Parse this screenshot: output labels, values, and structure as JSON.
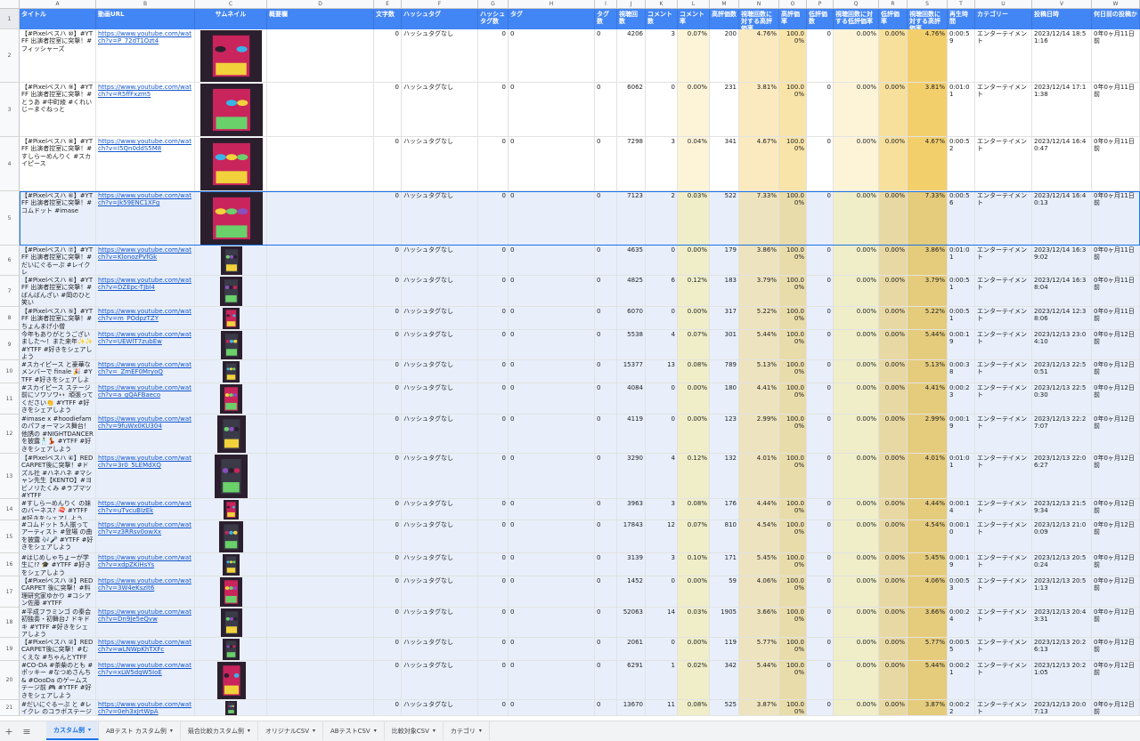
{
  "column_letters": [
    "A",
    "B",
    "C",
    "D",
    "E",
    "F",
    "G",
    "H",
    "I",
    "J",
    "K",
    "L",
    "M",
    "N",
    "O",
    "P",
    "Q",
    "R",
    "S",
    "T",
    "U",
    "V",
    "W"
  ],
  "headers": [
    "タイトル",
    "動画URL",
    "サムネイル",
    "概要欄",
    "文字数",
    "ハッシュタグ",
    "ハッシュタグ数",
    "タグ",
    "タグ数",
    "視聴回数",
    "コメント数",
    "コメント率",
    "高評価数",
    "視聴回数に対する高評価率",
    "高評価率",
    "低評価数",
    "視聴回数に対する低評価率",
    "低評価率",
    "視聴回数に対する高評価率",
    "再生時間",
    "カテゴリー",
    "投稿日時",
    "何日前の投稿か"
  ],
  "row_numbers": [
    "1",
    "2",
    "3",
    "4",
    "5",
    "6",
    "7",
    "8",
    "9",
    "10",
    "11",
    "12",
    "13",
    "14",
    "15",
    "16",
    "17",
    "18",
    "19",
    "20",
    "21"
  ],
  "rows": [
    {
      "title": "【#Pixelベスハ ⑩】#YTFF 出演者控室に突撃！#フィッシャーズ",
      "url": "https://www.youtube.com/watch?v=P_72dT1Ozt4",
      "desc": "",
      "chars": "0",
      "hashtag": "ハッシュタグなし",
      "htcount": "0",
      "tag": "0",
      "tagcount": "0",
      "views": "4206",
      "comments": "3",
      "crate": "0.07%",
      "likes": "200",
      "lvrate": "4.76%",
      "lrate": "100.00%",
      "dislikes": "0",
      "dvrate": "0.00%",
      "drate": "0.00%",
      "lvrate2": "4.76%",
      "duration": "0:00:59",
      "category": "エンターテイメント",
      "posted": "2023/12/14 18:51:16",
      "ago": "0年0ヶ月11日前"
    },
    {
      "title": "【#Pixelベスハ ⑨】#YTFF 出演者控室に突撃！#とうあ #中町綾 #くれいじーまぐねっと",
      "url": "https://www.youtube.com/watch?v=R5ffFxzm5",
      "desc": "",
      "chars": "0",
      "hashtag": "ハッシュタグなし",
      "htcount": "0",
      "tag": "0",
      "tagcount": "0",
      "views": "6062",
      "comments": "0",
      "crate": "0.00%",
      "likes": "231",
      "lvrate": "3.81%",
      "lrate": "100.00%",
      "dislikes": "0",
      "dvrate": "0.00%",
      "drate": "0.00%",
      "lvrate2": "3.81%",
      "duration": "0:01:01",
      "category": "エンターテイメント",
      "posted": "2023/12/14 17:11:38",
      "ago": "0年0ヶ月11日前"
    },
    {
      "title": "【#Pixelベスハ ⑧】#YTFF 出演者控室に突撃！#すしらーめんりく #スカイピース",
      "url": "https://www.youtube.com/watch?v=I5Qn0ddS5M8",
      "desc": "",
      "chars": "0",
      "hashtag": "ハッシュタグなし",
      "htcount": "0",
      "tag": "0",
      "tagcount": "0",
      "views": "7298",
      "comments": "3",
      "crate": "0.04%",
      "likes": "341",
      "lvrate": "4.67%",
      "lrate": "100.00%",
      "dislikes": "0",
      "dvrate": "0.00%",
      "drate": "0.00%",
      "lvrate2": "4.67%",
      "duration": "0:00:52",
      "category": "エンターテイメント",
      "posted": "2023/12/14 16:40:47",
      "ago": "0年0ヶ月11日前"
    },
    {
      "title": "【#Pixelベスハ ⑥】#YTFF 出演者控室に突撃！#コムドット #imase",
      "url": "https://www.youtube.com/watch?v=Jk59ENC1XFg",
      "desc": "",
      "chars": "0",
      "hashtag": "ハッシュタグなし",
      "htcount": "0",
      "tag": "0",
      "tagcount": "0",
      "views": "7123",
      "comments": "2",
      "crate": "0.03%",
      "likes": "522",
      "lvrate": "7.33%",
      "lrate": "100.00%",
      "dislikes": "0",
      "dvrate": "0.00%",
      "drate": "0.00%",
      "lvrate2": "7.33%",
      "duration": "0:00:56",
      "category": "エンターテイメント",
      "posted": "2023/12/14 16:40:13",
      "ago": "0年0ヶ月11日前"
    },
    {
      "title": "【#Pixelベスハ ⑦】#YTFF 出演者控室に突撃！#だいにぐるーぷ #レイクレ",
      "url": "https://www.youtube.com/watch?v=KlonozPVfGk",
      "desc": "",
      "chars": "0",
      "hashtag": "ハッシュタグなし",
      "htcount": "0",
      "tag": "0",
      "tagcount": "0",
      "views": "4635",
      "comments": "0",
      "crate": "0.00%",
      "likes": "179",
      "lvrate": "3.86%",
      "lrate": "100.00%",
      "dislikes": "0",
      "dvrate": "0.00%",
      "drate": "0.00%",
      "lvrate2": "3.86%",
      "duration": "0:01:01",
      "category": "エンターテイメント",
      "posted": "2023/12/14 16:39:02",
      "ago": "0年0ヶ月11日前"
    },
    {
      "title": "【#Pixelベスハ ⑥】#YTFF 出演者控室に突撃！#ばんばんざい #岡のひと笑い",
      "url": "https://www.youtube.com/watch?v=DZEpc-TJbl4",
      "desc": "",
      "chars": "0",
      "hashtag": "ハッシュタグなし",
      "htcount": "0",
      "tag": "0",
      "tagcount": "0",
      "views": "4825",
      "comments": "6",
      "crate": "0.12%",
      "likes": "183",
      "lvrate": "3.79%",
      "lrate": "100.00%",
      "dislikes": "0",
      "dvrate": "0.00%",
      "drate": "0.00%",
      "lvrate2": "3.79%",
      "duration": "0:00:51",
      "category": "エンターテイメント",
      "posted": "2023/12/14 16:38:04",
      "ago": "0年0ヶ月11日前"
    },
    {
      "title": "【#Pixelベスハ ⑤】#YTFF 出演者控室に突撃！#ちょんまげ小僧",
      "url": "https://www.youtube.com/watch?v=m_POdpzTZY",
      "desc": "",
      "chars": "0",
      "hashtag": "ハッシュタグなし",
      "htcount": "0",
      "tag": "0",
      "tagcount": "0",
      "views": "6070",
      "comments": "0",
      "crate": "0.00%",
      "likes": "317",
      "lvrate": "5.22%",
      "lrate": "100.00%",
      "dislikes": "0",
      "dvrate": "0.00%",
      "drate": "0.00%",
      "lvrate2": "5.22%",
      "duration": "0:00:51",
      "category": "エンターテイメント",
      "posted": "2023/12/14 12:38:06",
      "ago": "0年0ヶ月11日前"
    },
    {
      "title": "今年もありがとうございました〜！また来年✨✨ #YTFF #好きをシェアしよう",
      "url": "https://www.youtube.com/watch?v=UEWlT7zubEw",
      "desc": "",
      "chars": "0",
      "hashtag": "ハッシュタグなし",
      "htcount": "0",
      "tag": "0",
      "tagcount": "0",
      "views": "5538",
      "comments": "4",
      "crate": "0.07%",
      "likes": "301",
      "lvrate": "5.44%",
      "lrate": "100.00%",
      "dislikes": "0",
      "dvrate": "0.00%",
      "drate": "0.00%",
      "lvrate2": "5.44%",
      "duration": "0:00:19",
      "category": "エンターテイメント",
      "posted": "2023/12/13 23:04:10",
      "ago": "0年0ヶ月12日前"
    },
    {
      "title": "#スカイピース と豪華なメンバーで finale 🎉 #YTFF #好きをシェアしよう",
      "url": "https://www.youtube.com/watch?v=_ZmEF0MryoQ",
      "desc": "",
      "chars": "0",
      "hashtag": "ハッシュタグなし",
      "htcount": "0",
      "tag": "0",
      "tagcount": "0",
      "views": "15377",
      "comments": "13",
      "crate": "0.08%",
      "likes": "789",
      "lvrate": "5.13%",
      "lrate": "100.00%",
      "dislikes": "0",
      "dvrate": "0.00%",
      "drate": "0.00%",
      "lvrate2": "5.13%",
      "duration": "0:00:38",
      "category": "エンターテイメント",
      "posted": "2023/12/13 22:50:51",
      "ago": "0年0ヶ月12日前"
    },
    {
      "title": "#スカイピース ステージ前にソワソワ👀 頑張ってください👏 #YTFF #好きをシェアしよう",
      "url": "https://www.youtube.com/watch?v=a_gQAFBaeco",
      "desc": "",
      "chars": "0",
      "hashtag": "ハッシュタグなし",
      "htcount": "0",
      "tag": "0",
      "tagcount": "0",
      "views": "4084",
      "comments": "0",
      "crate": "0.00%",
      "likes": "180",
      "lvrate": "4.41%",
      "lrate": "100.00%",
      "dislikes": "0",
      "dvrate": "0.00%",
      "drate": "0.00%",
      "lvrate2": "4.41%",
      "duration": "0:00:23",
      "category": "エンターテイメント",
      "posted": "2023/12/13 22:50:30",
      "ago": "0年0ヶ月12日前"
    },
    {
      "title": "#imase x #hoodiefam のパフォーマンス舞台！他誘の #NIGHTDANCER を披露🕺💃 #YTFF #好きをシェアしよう",
      "url": "https://www.youtube.com/watch?v=9fuWx0KU304",
      "desc": "",
      "chars": "0",
      "hashtag": "ハッシュタグなし",
      "htcount": "0",
      "tag": "0",
      "tagcount": "0",
      "views": "4119",
      "comments": "0",
      "crate": "0.00%",
      "likes": "123",
      "lvrate": "2.99%",
      "lrate": "100.00%",
      "dislikes": "0",
      "dvrate": "0.00%",
      "drate": "0.00%",
      "lvrate2": "2.99%",
      "duration": "0:00:19",
      "category": "エンターテイメント",
      "posted": "2023/12/13 22:27:07",
      "ago": "0年0ヶ月12日前"
    },
    {
      "title": "【#Pixelベスハ ④】RED CARPET後に突撃！#ドズル社 #ハネハネ #マシャン先生【KENTO】#ヨビノリたくみ #ラブマツ #YTFF",
      "url": "https://www.youtube.com/watch?v=3r0_5LEMdXQ",
      "desc": "",
      "chars": "0",
      "hashtag": "ハッシュタグなし",
      "htcount": "0",
      "tag": "0",
      "tagcount": "0",
      "views": "3290",
      "comments": "4",
      "crate": "0.12%",
      "likes": "132",
      "lvrate": "4.01%",
      "lrate": "100.00%",
      "dislikes": "0",
      "dvrate": "0.00%",
      "drate": "0.00%",
      "lvrate2": "4.01%",
      "duration": "0:01:01",
      "category": "エンターテイメント",
      "posted": "2023/12/13 22:06:27",
      "ago": "0年0ヶ月12日前"
    },
    {
      "title": "#すしらーめんりく の妹のバーネス? 🍣 #YTFF #好きをシェアしよう",
      "url": "https://www.youtube.com/watch?v=uTvcuBIzEk",
      "desc": "",
      "chars": "0",
      "hashtag": "ハッシュタグなし",
      "htcount": "0",
      "tag": "0",
      "tagcount": "0",
      "views": "3963",
      "comments": "3",
      "crate": "0.08%",
      "likes": "176",
      "lvrate": "4.44%",
      "lrate": "100.00%",
      "dislikes": "0",
      "dvrate": "0.00%",
      "drate": "0.00%",
      "lvrate2": "4.44%",
      "duration": "0:00:14",
      "category": "エンターテイメント",
      "posted": "2023/12/13 21:59:34",
      "ago": "0年0ヶ月12日前"
    },
    {
      "title": "#コムドット 5人揃ってアーティスト #登場 の曲を披露 🎶🎤 #YTFF #好きをシェアしよう",
      "url": "https://www.youtube.com/watch?v=z3RRsv0owXx",
      "desc": "",
      "chars": "0",
      "hashtag": "ハッシュタグなし",
      "htcount": "0",
      "tag": "0",
      "tagcount": "0",
      "views": "17843",
      "comments": "12",
      "crate": "0.07%",
      "likes": "810",
      "lvrate": "4.54%",
      "lrate": "100.00%",
      "dislikes": "0",
      "dvrate": "0.00%",
      "drate": "0.00%",
      "lvrate2": "4.54%",
      "duration": "0:00:10",
      "category": "エンターテイメント",
      "posted": "2023/12/13 21:00:09",
      "ago": "0年0ヶ月12日前"
    },
    {
      "title": "#はじめしゃちょーが学生に!? 🎓 #YTFF #好きをシェアしよう",
      "url": "https://www.youtube.com/watch?v=xdpZKiHsYs",
      "desc": "",
      "chars": "0",
      "hashtag": "ハッシュタグなし",
      "htcount": "0",
      "tag": "0",
      "tagcount": "0",
      "views": "3139",
      "comments": "3",
      "crate": "0.10%",
      "likes": "171",
      "lvrate": "5.45%",
      "lrate": "100.00%",
      "dislikes": "0",
      "dvrate": "0.00%",
      "drate": "0.00%",
      "lvrate2": "5.45%",
      "duration": "0:00:19",
      "category": "エンターテイメント",
      "posted": "2023/12/13 20:50:24",
      "ago": "0年0ヶ月12日前"
    },
    {
      "title": "【#Pixelベスハ ③】RED CARPET 後に突撃！#料理研究家ゆかり #コシアン佐藤 #YTFF",
      "url": "https://www.youtube.com/watch?v=3W4eKszIt6",
      "desc": "",
      "chars": "0",
      "hashtag": "ハッシュタグなし",
      "htcount": "0",
      "tag": "0",
      "tagcount": "0",
      "views": "1452",
      "comments": "0",
      "crate": "0.00%",
      "likes": "59",
      "lvrate": "4.06%",
      "lrate": "100.00%",
      "dislikes": "0",
      "dvrate": "0.00%",
      "drate": "0.00%",
      "lvrate2": "4.06%",
      "duration": "0:00:53",
      "category": "エンターテイメント",
      "posted": "2023/12/13 20:51:13",
      "ago": "0年0ヶ月12日前"
    },
    {
      "title": "#平成フラミンゴ の秦会初独奏・初舞台♪ ドキドキ #YTFF #好きをシェアしよう",
      "url": "https://www.youtube.com/watch?v=Dn9Je5eQvw",
      "desc": "",
      "chars": "0",
      "hashtag": "ハッシュタグなし",
      "htcount": "0",
      "tag": "0",
      "tagcount": "0",
      "views": "52063",
      "comments": "14",
      "crate": "0.03%",
      "likes": "1905",
      "lvrate": "3.66%",
      "lrate": "100.00%",
      "dislikes": "0",
      "dvrate": "0.00%",
      "drate": "0.00%",
      "lvrate2": "3.66%",
      "duration": "0:00:24",
      "category": "エンターテイメント",
      "posted": "2023/12/13 20:43:31",
      "ago": "0年0ヶ月12日前"
    },
    {
      "title": "【#Pixelベスハ ②】RED CARPET後に突撃！#むくえな #ちゃんとYTFF",
      "url": "https://www.youtube.com/watch?v=wLNWpKhTXFc",
      "desc": "",
      "chars": "0",
      "hashtag": "ハッシュタグなし",
      "htcount": "0",
      "tag": "0",
      "tagcount": "0",
      "views": "2061",
      "comments": "0",
      "crate": "0.00%",
      "likes": "119",
      "lvrate": "5.77%",
      "lrate": "100.00%",
      "dislikes": "0",
      "dvrate": "0.00%",
      "drate": "0.00%",
      "lvrate2": "5.77%",
      "duration": "0:00:55",
      "category": "エンターテイメント",
      "posted": "2023/12/13 20:26:13",
      "ago": "0年0ヶ月12日前"
    },
    {
      "title": "#CO-DA #茶柴のとも #ポッキー #なつめさんち & #OooDa のゲームステージ前 🎮 #YTFF #好きをシェアしよう",
      "url": "https://www.youtube.com/watch?v=xLW5dqW5IoE",
      "desc": "",
      "chars": "0",
      "hashtag": "ハッシュタグなし",
      "htcount": "0",
      "tag": "0",
      "tagcount": "0",
      "views": "6291",
      "comments": "1",
      "crate": "0.02%",
      "likes": "342",
      "lvrate": "5.44%",
      "lrate": "100.00%",
      "dislikes": "0",
      "dvrate": "0.00%",
      "drate": "0.00%",
      "lvrate2": "5.44%",
      "duration": "0:00:21",
      "category": "エンターテイメント",
      "posted": "2023/12/13 20:21:05",
      "ago": "0年0ヶ月12日前"
    },
    {
      "title": "#だいにぐるーぷ と #レイクレ のコラボステージ前",
      "url": "https://www.youtube.com/watch?v=0eh3xJrtWpA",
      "desc": "",
      "chars": "0",
      "hashtag": "ハッシュタグなし",
      "htcount": "0",
      "tag": "0",
      "tagcount": "0",
      "views": "13670",
      "comments": "11",
      "crate": "0.08%",
      "likes": "525",
      "lvrate": "3.87%",
      "lrate": "100.00%",
      "dislikes": "0",
      "dvrate": "0.00%",
      "drate": "0.00%",
      "lvrate2": "3.87%",
      "duration": "0:00:22",
      "category": "エンターテイメント",
      "posted": "2023/12/13 20:07:13",
      "ago": "0年0ヶ月12日前"
    }
  ],
  "thumb_colors": [
    "#2b1f2e",
    "#c9245c",
    "#38b4e8",
    "#f1d23b",
    "#6ad06a",
    "#8a4fbf"
  ],
  "tabbar": {
    "add_label": "+",
    "menu_label": "≡",
    "tabs": [
      {
        "label": "カスタム例",
        "active": true
      },
      {
        "label": "ABテスト カスタム例",
        "active": false
      },
      {
        "label": "競合比較カスタム例",
        "active": false
      },
      {
        "label": "オリジナルCSV",
        "active": false
      },
      {
        "label": "ABテストCSV",
        "active": false
      },
      {
        "label": "比較対象CSV",
        "active": false
      },
      {
        "label": "カテゴリ",
        "active": false
      }
    ]
  }
}
